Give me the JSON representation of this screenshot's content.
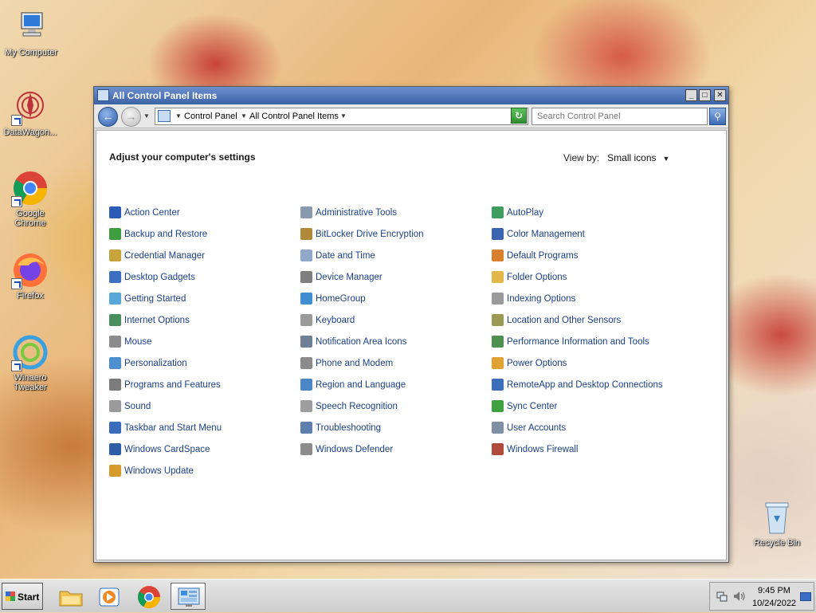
{
  "desktop": {
    "icons": [
      {
        "label": "My Computer",
        "icon": "computer-icon"
      },
      {
        "label": "DataWagon...",
        "icon": "datawagon-icon"
      },
      {
        "label": "Google Chrome",
        "icon": "chrome-icon"
      },
      {
        "label": "Firefox",
        "icon": "firefox-icon"
      },
      {
        "label": "Winaero Tweaker",
        "icon": "winaero-tweaker-icon"
      },
      {
        "label": "Recycle Bin",
        "icon": "recycle-bin-icon"
      }
    ]
  },
  "window": {
    "title": "All Control Panel Items",
    "buttons": {
      "minimize": "_",
      "maximize": "□",
      "close": "✕"
    },
    "address": {
      "segments": [
        "Control Panel",
        "All Control Panel Items"
      ]
    },
    "search_placeholder": "Search Control Panel",
    "heading": "Adjust your computer's settings",
    "view_by_label": "View by:",
    "view_by_value": "Small icons",
    "columns": [
      [
        {
          "label": "Action Center",
          "color": "#2b5cb8"
        },
        {
          "label": "Backup and Restore",
          "color": "#3f9e3f"
        },
        {
          "label": "Credential Manager",
          "color": "#c9a33c"
        },
        {
          "label": "Desktop Gadgets",
          "color": "#3a6fc4"
        },
        {
          "label": "Getting Started",
          "color": "#58a7d8"
        },
        {
          "label": "Internet Options",
          "color": "#4a8f5e"
        },
        {
          "label": "Mouse",
          "color": "#8c8c8c"
        },
        {
          "label": "Personalization",
          "color": "#4d8fcf"
        },
        {
          "label": "Programs and Features",
          "color": "#7b7b7b"
        },
        {
          "label": "Sound",
          "color": "#9a9a9a"
        },
        {
          "label": "Taskbar and Start Menu",
          "color": "#3b6dbd"
        },
        {
          "label": "Windows CardSpace",
          "color": "#2f5ea9"
        },
        {
          "label": "Windows Update",
          "color": "#d69a2b"
        }
      ],
      [
        {
          "label": "Administrative Tools",
          "color": "#8a9aae"
        },
        {
          "label": "BitLocker Drive Encryption",
          "color": "#b08a3a"
        },
        {
          "label": "Date and Time",
          "color": "#8fa8c8"
        },
        {
          "label": "Device Manager",
          "color": "#7f7f7f"
        },
        {
          "label": "HomeGroup",
          "color": "#3f8fd0"
        },
        {
          "label": "Keyboard",
          "color": "#9a9a9a"
        },
        {
          "label": "Notification Area Icons",
          "color": "#6f7f96"
        },
        {
          "label": "Phone and Modem",
          "color": "#8b8b8b"
        },
        {
          "label": "Region and Language",
          "color": "#4b86c7"
        },
        {
          "label": "Speech Recognition",
          "color": "#9e9e9e"
        },
        {
          "label": "Troubleshooting",
          "color": "#5f7fae"
        },
        {
          "label": "Windows Defender",
          "color": "#8c8c8c"
        }
      ],
      [
        {
          "label": "AutoPlay",
          "color": "#3f9e5f"
        },
        {
          "label": "Color Management",
          "color": "#3a64b0"
        },
        {
          "label": "Default Programs",
          "color": "#d9802f"
        },
        {
          "label": "Folder Options",
          "color": "#e2b84a"
        },
        {
          "label": "Indexing Options",
          "color": "#9a9a9a"
        },
        {
          "label": "Location and Other Sensors",
          "color": "#9a9a55"
        },
        {
          "label": "Performance Information and Tools",
          "color": "#4f8f4f"
        },
        {
          "label": "Power Options",
          "color": "#e0a232"
        },
        {
          "label": "RemoteApp and Desktop Connections",
          "color": "#3b6db9"
        },
        {
          "label": "Sync Center",
          "color": "#3fa13f"
        },
        {
          "label": "User Accounts",
          "color": "#7f8fa5"
        },
        {
          "label": "Windows Firewall",
          "color": "#b04a3a"
        }
      ]
    ]
  },
  "taskbar": {
    "start_label": "Start",
    "apps": [
      {
        "name": "explorer",
        "icon": "folder-icon"
      },
      {
        "name": "media-player",
        "icon": "media-player-icon"
      },
      {
        "name": "chrome",
        "icon": "chrome-icon"
      },
      {
        "name": "control-panel",
        "icon": "control-panel-icon",
        "active": true
      }
    ],
    "time": "9:45 PM",
    "date": "10/24/2022"
  }
}
